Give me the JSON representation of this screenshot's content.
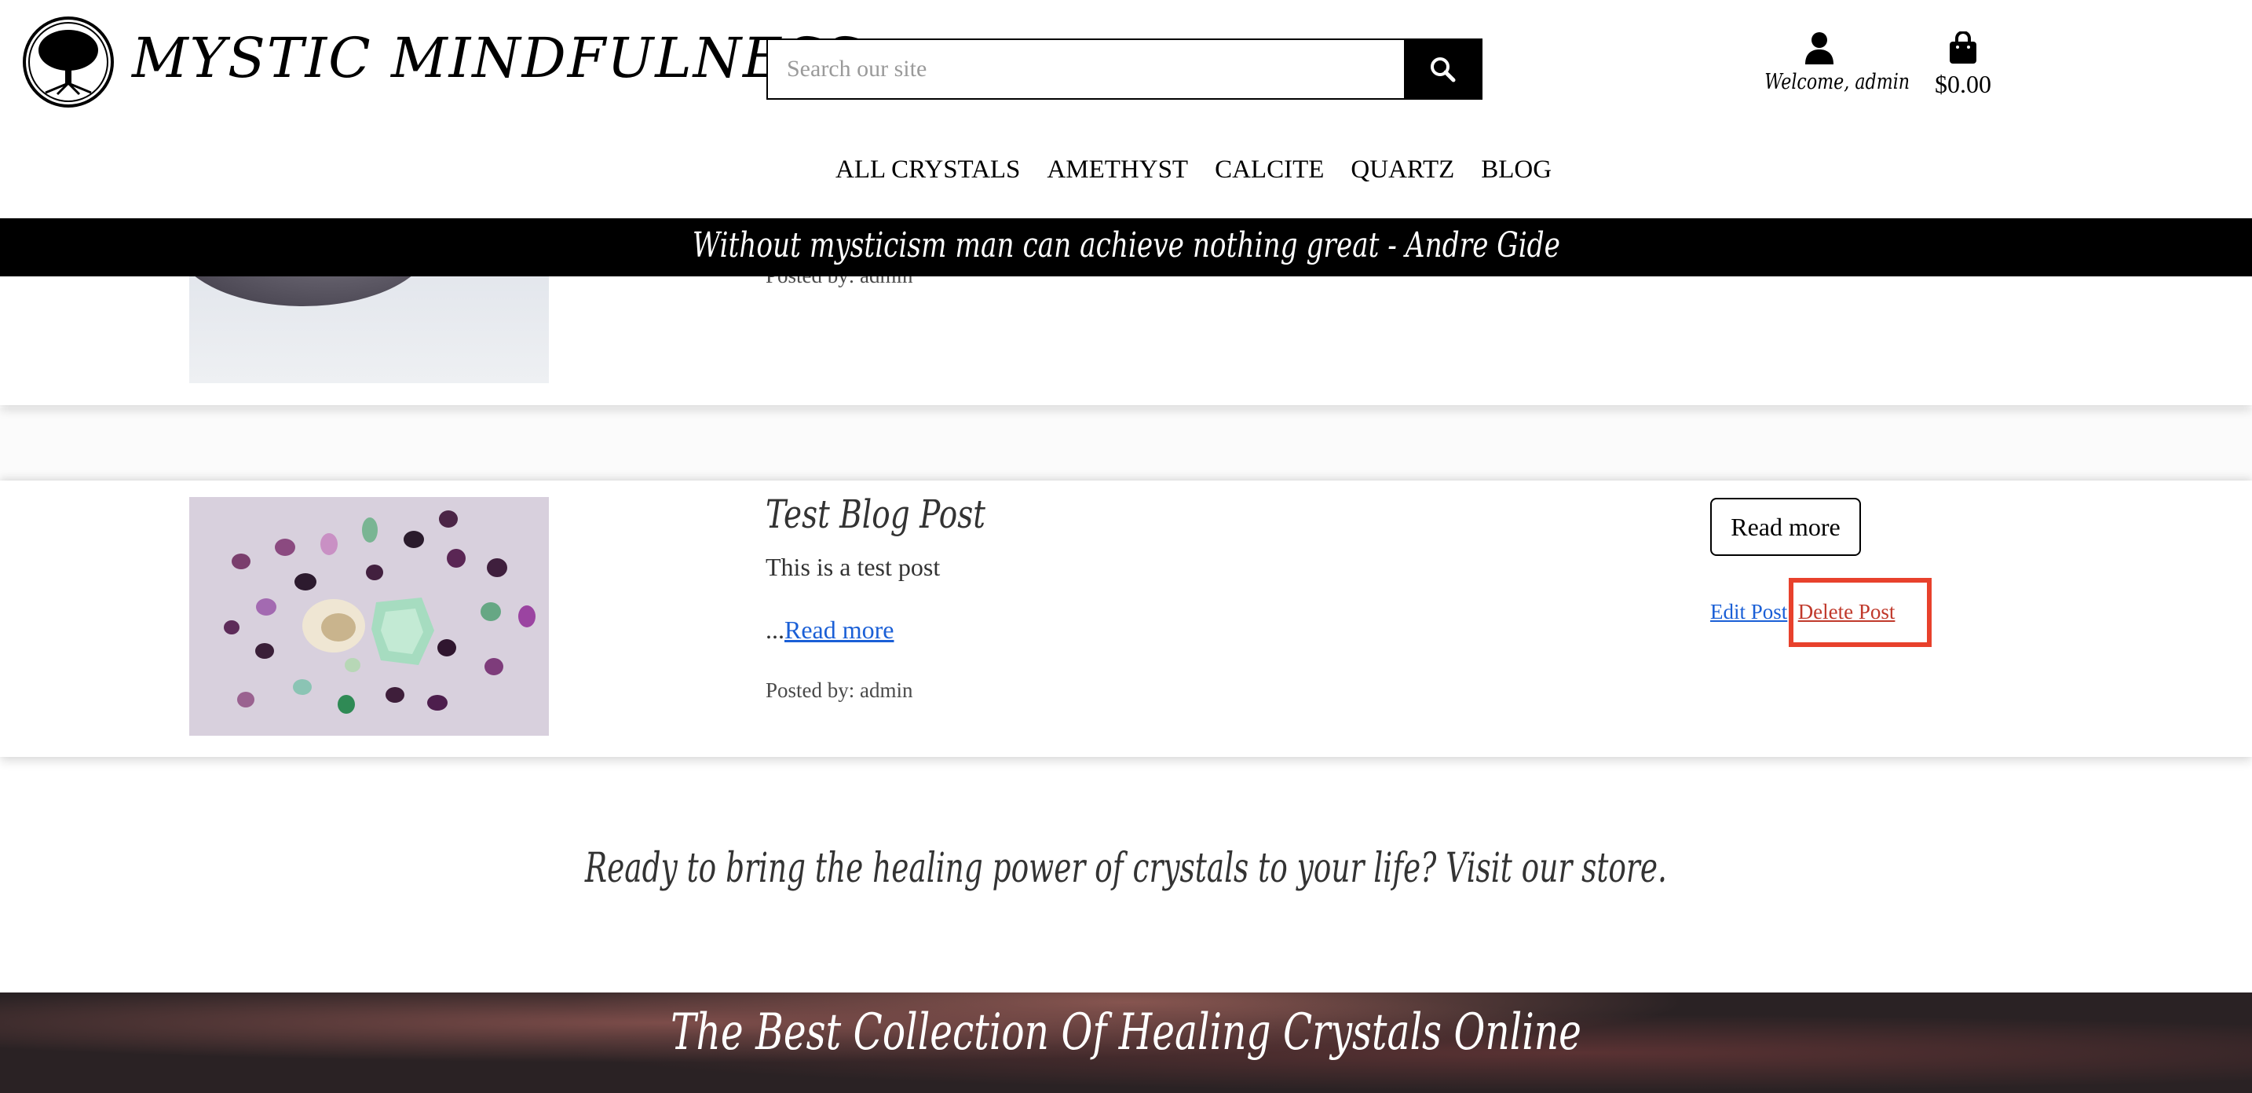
{
  "header": {
    "site_title": "MYSTIC MINDFULNESS",
    "logo_icon": "tree-of-life-icon",
    "search": {
      "placeholder": "Search our site",
      "value": ""
    },
    "account_label": "Welcome, admin",
    "bag_total": "$0.00"
  },
  "nav": {
    "items": [
      "ALL CRYSTALS",
      "AMETHYST",
      "CALCITE",
      "QUARTZ",
      "BLOG"
    ]
  },
  "quote_banner": "Without mysticism man can achieve nothing great - Andre Gide",
  "posts": [
    {
      "posted_by": "Posted by: admin"
    },
    {
      "title": "Test Blog Post",
      "excerpt": "This is a test post",
      "ellipsis": "...",
      "read_more_link": "Read more",
      "posted_by": "Posted by: admin",
      "read_more_button": "Read more",
      "edit_label": "Edit Post",
      "separator": "|",
      "delete_label": "Delete Post"
    }
  ],
  "cta_text": "Ready to bring the healing power of crystals to your life? Visit our store.",
  "footer_title": "The Best Collection Of Healing Crystals Online",
  "colors": {
    "link": "#1a5fd6",
    "delete_link": "#c0392b",
    "highlight": "#e8412c",
    "banner_bg": "#000000"
  }
}
